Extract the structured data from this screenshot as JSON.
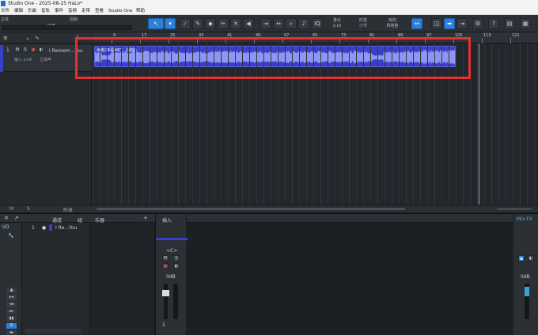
{
  "window": {
    "title": "Studio One - 2025-08-25 HaLo*"
  },
  "menu": [
    "文件",
    "编辑",
    "乐曲",
    "音轨",
    "事件",
    "音频",
    "走带",
    "查看",
    "Studio One",
    "帮助"
  ],
  "toolbar": {
    "preset_label": "主体",
    "control_label": "控制",
    "value": "0dB",
    "iq_label": "IQ",
    "quantize_label": "量化",
    "quantize_value": "1/16",
    "timebase_label": "时基",
    "timebase_value": "小节",
    "snap_label": "吸附",
    "snap_value": "网格整",
    "help_label": "?"
  },
  "tracks_header": {
    "count_label": "1"
  },
  "track": {
    "number": "1",
    "mute": "M",
    "solo": "S",
    "name": "I Remem...You",
    "input": "输入 L+R",
    "output": "立体声"
  },
  "ruler": {
    "marks": [
      "1",
      "9",
      "17",
      "25",
      "33",
      "41",
      "49",
      "57",
      "65",
      "73",
      "81",
      "89",
      "97",
      "105",
      "113",
      "121"
    ]
  },
  "clip": {
    "label": "演练(英语)MIT...(翻唱)"
  },
  "arrange_footer": {
    "m": "M",
    "s": "S",
    "label": "附录"
  },
  "lower": {
    "io_label": "I/O",
    "list_header": "通道",
    "list_col2": "组",
    "list_col3": "乐器",
    "list_item_number": "1",
    "list_item_name": "I Re...You",
    "strip_insert_label": "插入",
    "strip_mute": "M",
    "strip_solo": "S",
    "strip_pan": "<C>",
    "strip_gain": "0dB",
    "strip_number": "1",
    "mix_fx_label": "Mix FX",
    "main_gain": "0dB",
    "footer_label": "调音"
  },
  "colors": {
    "clip": "#3a3fc8",
    "highlight": "#e53131",
    "accent": "#2e7fd8"
  }
}
